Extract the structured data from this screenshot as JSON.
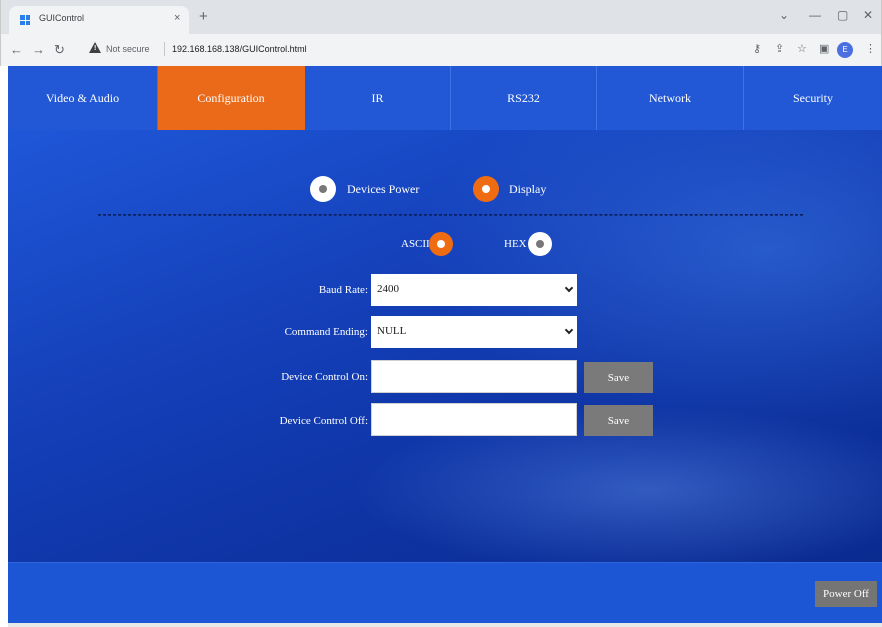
{
  "browser": {
    "tab_title": "GUIControl",
    "tab_close": "×",
    "new_tab": "+",
    "url_warning": "Not secure",
    "url": "192.168.168.138/GUIControl.html",
    "profile_initial": "E",
    "icons": [
      "back-arrow-icon",
      "forward-arrow-icon",
      "reload-icon",
      "key-icon",
      "share-icon",
      "star-icon",
      "sidepanel-icon",
      "menu-icon"
    ]
  },
  "nav": {
    "tabs": [
      {
        "label": "Video & Audio",
        "active": false
      },
      {
        "label": "Configuration",
        "active": true
      },
      {
        "label": "IR",
        "active": false
      },
      {
        "label": "RS232",
        "active": false
      },
      {
        "label": "Network",
        "active": false
      },
      {
        "label": "Security",
        "active": false
      }
    ]
  },
  "config": {
    "target_options": [
      {
        "label": "Devices Power",
        "selected": false
      },
      {
        "label": "Display",
        "selected": true
      }
    ],
    "format_options": [
      {
        "label": "ASCII",
        "selected": true
      },
      {
        "label": "HEX",
        "selected": false
      }
    ],
    "baud_rate": {
      "label": "Baud Rate:",
      "value": "2400"
    },
    "command_ending": {
      "label": "Command Ending:",
      "value": "NULL"
    },
    "device_control_on": {
      "label": "Device Control On:",
      "value": "",
      "button": "Save"
    },
    "device_control_off": {
      "label": "Device Control Off:",
      "value": "",
      "button": "Save"
    }
  },
  "footer": {
    "power_off": "Power Off"
  },
  "colors": {
    "accent": "#ea6a19",
    "nav_bg": "#2258d6",
    "button_gray": "#7a7a7a"
  }
}
